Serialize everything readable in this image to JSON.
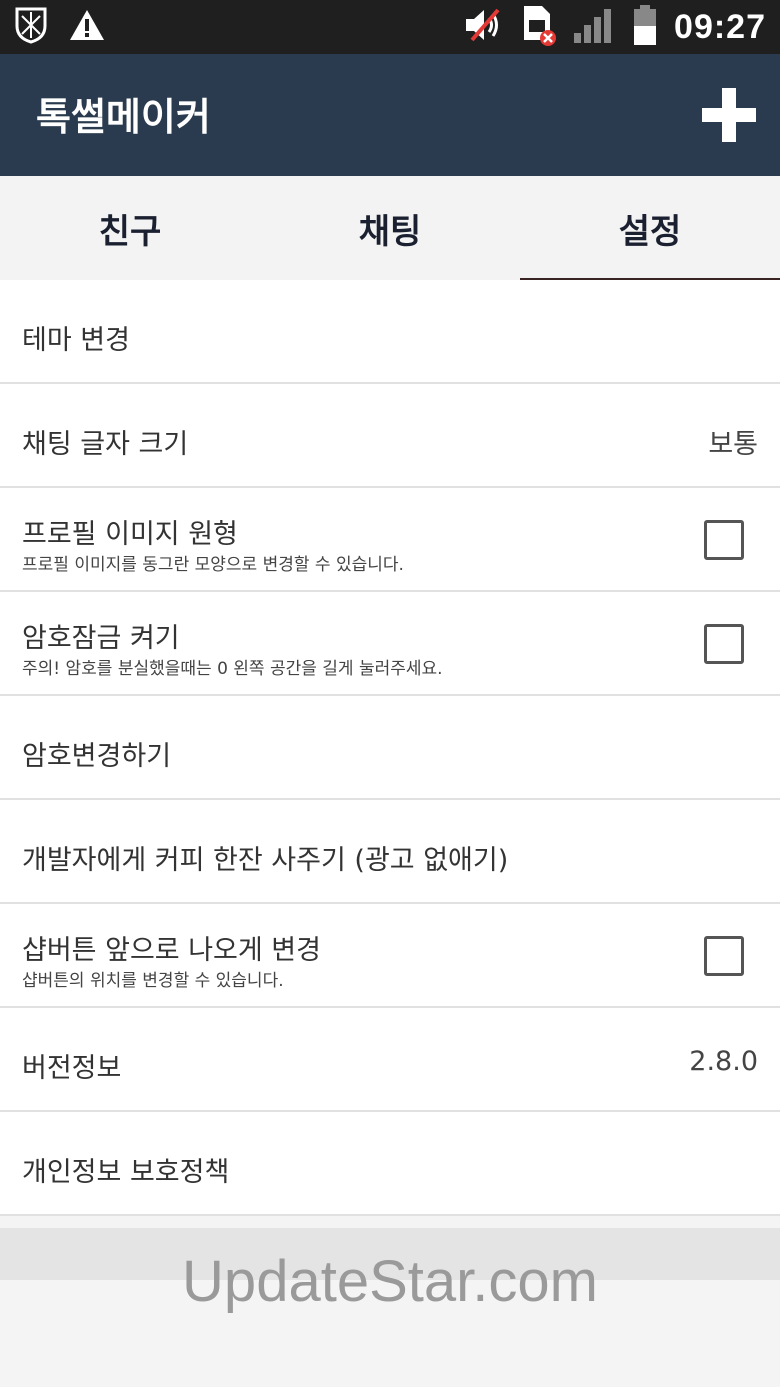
{
  "status_bar": {
    "time": "09:27",
    "icons": [
      "shield-icon",
      "warning-icon",
      "volume-muted-icon",
      "sim-error-icon",
      "signal-icon",
      "battery-icon"
    ]
  },
  "app_bar": {
    "title": "톡썰메이커",
    "add_icon": "plus-icon"
  },
  "tabs": [
    {
      "label": "친구",
      "active": false
    },
    {
      "label": "채팅",
      "active": false
    },
    {
      "label": "설정",
      "active": true
    }
  ],
  "settings": {
    "theme": {
      "title": "테마 변경"
    },
    "font_size": {
      "title": "채팅 글자 크기",
      "value": "보통"
    },
    "profile_round": {
      "title": "프로필 이미지 원형",
      "subtitle": "프로필 이미지를 동그란 모양으로 변경할 수 있습니다.",
      "checked": false
    },
    "lock": {
      "title": "암호잠금 켜기",
      "subtitle": "주의! 암호를 분실했을때는 0 왼쪽 공간을 길게 눌러주세요.",
      "checked": false
    },
    "change_password": {
      "title": "암호변경하기"
    },
    "buy_coffee": {
      "title": "개발자에게 커피 한잔 사주기 (광고 없애기)"
    },
    "shop_button": {
      "title": "샵버튼 앞으로 나오게 변경",
      "subtitle": "샵버튼의 위치를 변경할 수 있습니다.",
      "checked": false
    },
    "version": {
      "title": "버전정보",
      "value": "2.8.0"
    },
    "privacy": {
      "title": "개인정보 보호정책"
    }
  },
  "watermark": "UpdateStar.com",
  "colors": {
    "app_bar": "#2b3b4f",
    "status_bar": "#1f1f1f",
    "tab_indicator": "#3a2323"
  }
}
